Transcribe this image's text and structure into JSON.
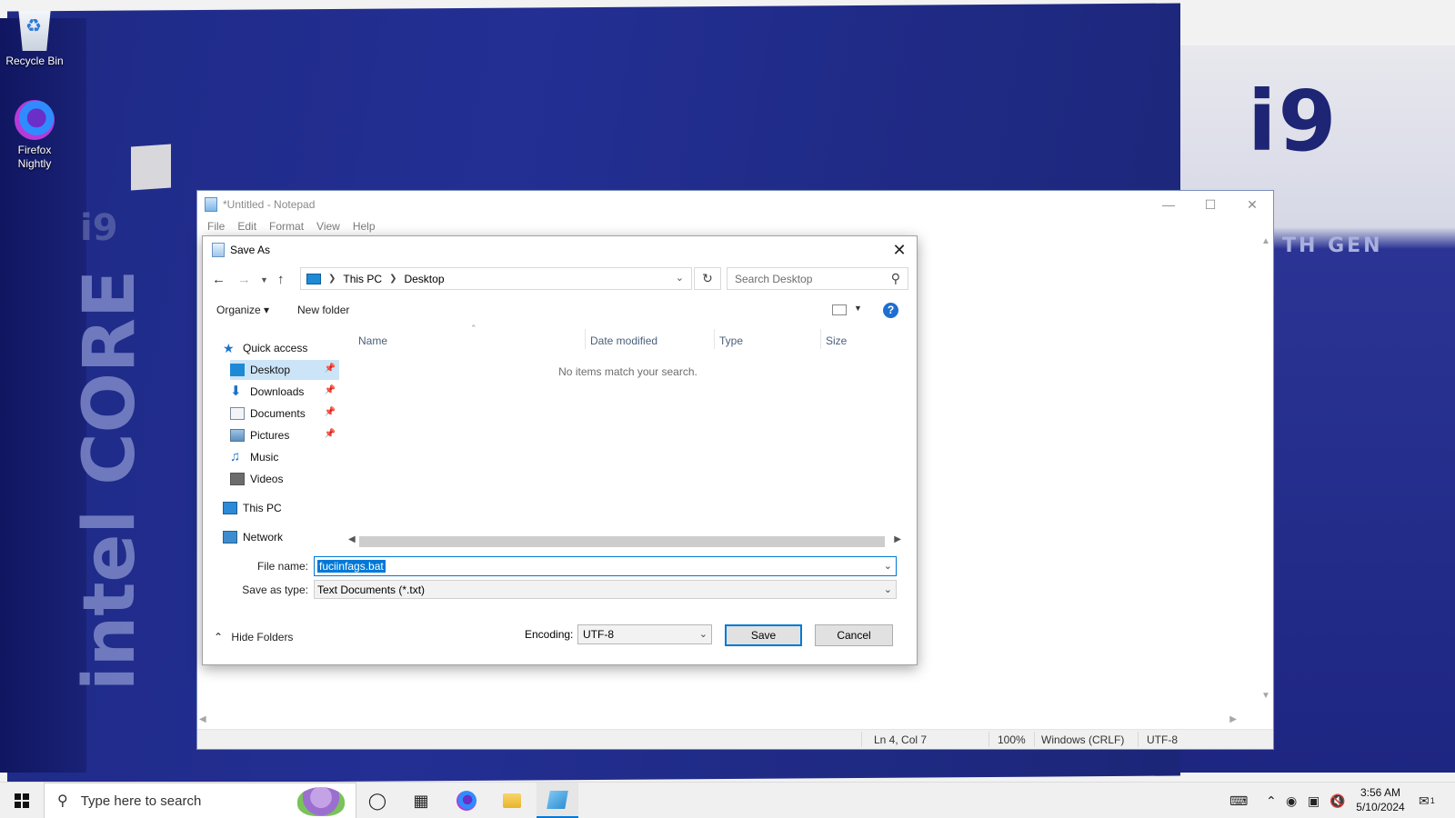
{
  "desktop": {
    "icons": [
      {
        "label": "Recycle Bin"
      },
      {
        "label": "Firefox Nightly"
      }
    ],
    "wallpaper_text": {
      "chip": "i9",
      "gen": "TH GEN",
      "brand": "intel CORE"
    }
  },
  "notepad": {
    "title": "*Untitled - Notepad",
    "menu": [
      "File",
      "Edit",
      "Format",
      "View",
      "Help"
    ],
    "status": {
      "position": "Ln 4, Col 7",
      "zoom": "100%",
      "line_ending": "Windows (CRLF)",
      "encoding": "UTF-8"
    }
  },
  "dialog": {
    "title": "Save As",
    "breadcrumb": [
      "This PC",
      "Desktop"
    ],
    "search_placeholder": "Search Desktop",
    "toolbar": {
      "organize": "Organize",
      "new_folder": "New folder",
      "help": "?"
    },
    "nav": {
      "quick_access": "Quick access",
      "items": [
        {
          "label": "Desktop",
          "pinned": true,
          "selected": true
        },
        {
          "label": "Downloads",
          "pinned": true
        },
        {
          "label": "Documents",
          "pinned": true
        },
        {
          "label": "Pictures",
          "pinned": true
        },
        {
          "label": "Music",
          "pinned": false
        },
        {
          "label": "Videos",
          "pinned": false
        }
      ],
      "this_pc": "This PC",
      "network": "Network"
    },
    "columns": [
      "Name",
      "Date modified",
      "Type",
      "Size"
    ],
    "empty_message": "No items match your search.",
    "file_name_label": "File name:",
    "file_name_value": "fuciinfags.bat",
    "save_type_label": "Save as type:",
    "save_type_value": "Text Documents (*.txt)",
    "hide_folders": "Hide Folders",
    "encoding_label": "Encoding:",
    "encoding_value": "UTF-8",
    "save_button": "Save",
    "cancel_button": "Cancel"
  },
  "taskbar": {
    "search_placeholder": "Type here to search",
    "clock_time": "3:56 AM",
    "clock_date": "5/10/2024",
    "notification_count": "1"
  }
}
